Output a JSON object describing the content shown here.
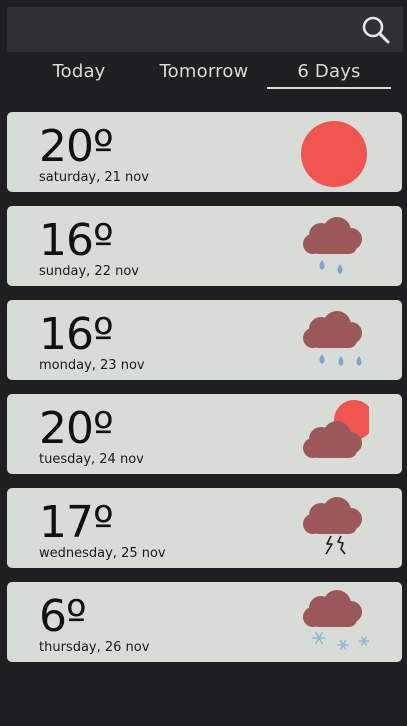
{
  "search": {
    "icon": "search-icon"
  },
  "tabs": [
    {
      "label": "Today"
    },
    {
      "label": "Tomorrow"
    },
    {
      "label": "6 Days"
    }
  ],
  "active_tab": "6 Days",
  "colors": {
    "background": "#1f1f21",
    "card": "#d8dcd6",
    "sun": "#f0564f",
    "cloud": "#9c5858",
    "rain": "#7ea6cc",
    "snow": "#8fb4d9"
  },
  "forecast": [
    {
      "temp": "20º",
      "date": "saturday, 21 nov",
      "icon": "sun-icon"
    },
    {
      "temp": "16º",
      "date": "sunday, 22 nov",
      "icon": "rain-cloud-icon"
    },
    {
      "temp": "16º",
      "date": "monday, 23 nov",
      "icon": "heavy-rain-cloud-icon"
    },
    {
      "temp": "20º",
      "date": "tuesday, 24 nov",
      "icon": "partly-cloudy-icon"
    },
    {
      "temp": "17º",
      "date": "wednesday, 25 nov",
      "icon": "thunderstorm-cloud-icon"
    },
    {
      "temp": "6º",
      "date": "thursday, 26 nov",
      "icon": "snow-cloud-icon"
    }
  ]
}
